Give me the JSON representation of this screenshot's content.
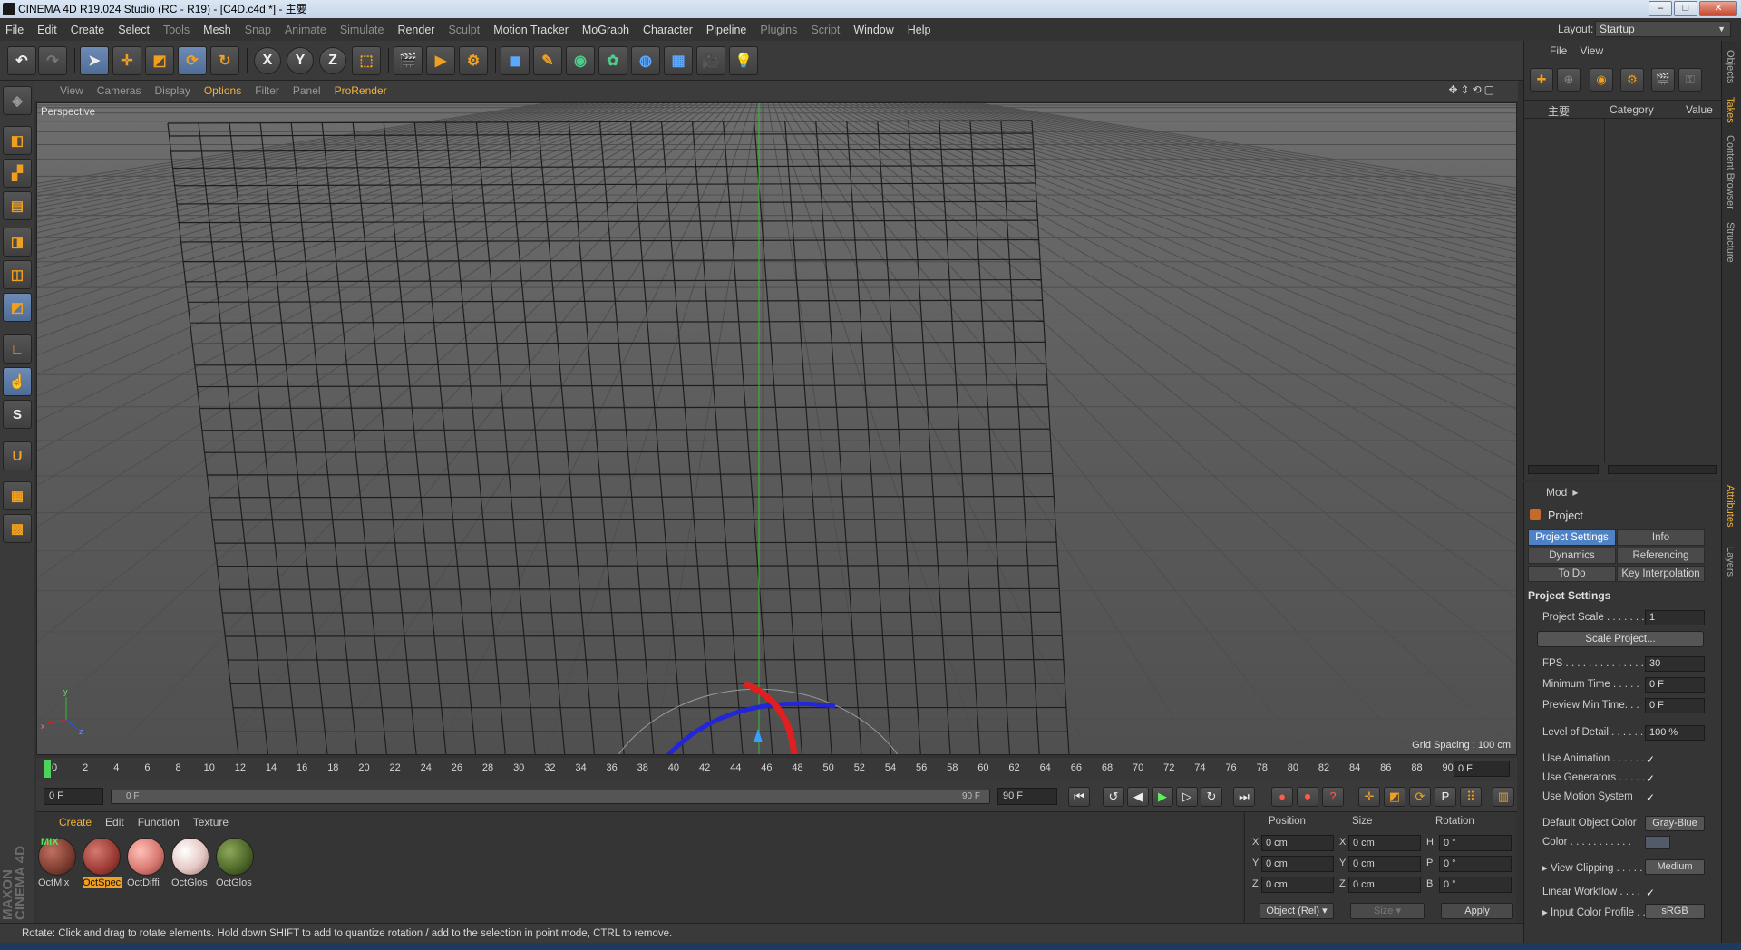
{
  "window": {
    "title": "CINEMA 4D R19.024 Studio (RC - R19) - [C4D.c4d *] - 主要",
    "controls": [
      "–",
      "□",
      "✕"
    ]
  },
  "menubar": {
    "items": [
      "File",
      "Edit",
      "Create",
      "Select",
      "Tools",
      "Mesh",
      "Snap",
      "Animate",
      "Simulate",
      "Render",
      "Sculpt",
      "Motion Tracker",
      "MoGraph",
      "Character",
      "Pipeline",
      "Plugins",
      "Script",
      "Window",
      "Help"
    ]
  },
  "layout": {
    "label": "Layout:",
    "value": "Startup"
  },
  "viewport": {
    "menu": [
      "View",
      "Cameras",
      "Display",
      "Options",
      "Filter",
      "Panel",
      "ProRender"
    ],
    "label": "Perspective",
    "grid_spacing": "Grid Spacing : 100 cm",
    "axis": {
      "x": "x",
      "y": "y",
      "z": "z"
    }
  },
  "timeline": {
    "ticks": [
      "0",
      "2",
      "4",
      "6",
      "8",
      "10",
      "12",
      "14",
      "16",
      "18",
      "20",
      "22",
      "24",
      "26",
      "28",
      "30",
      "32",
      "34",
      "36",
      "38",
      "40",
      "42",
      "44",
      "46",
      "48",
      "50",
      "52",
      "54",
      "56",
      "58",
      "60",
      "62",
      "64",
      "66",
      "68",
      "70",
      "72",
      "74",
      "76",
      "78",
      "80",
      "82",
      "84",
      "86",
      "88",
      "90"
    ],
    "end_field": "0 F",
    "start": "0 F",
    "slider_start": "0 F",
    "slider_end": "90 F",
    "max": "90 F"
  },
  "materials": {
    "menu": [
      "Create",
      "Edit",
      "Function",
      "Texture"
    ],
    "items": [
      {
        "name": "OctMix",
        "color": "#7a3b2e",
        "tag": "MIX"
      },
      {
        "name": "OctSpec",
        "color": "#9a3a32"
      },
      {
        "name": "OctDiffi",
        "color": "#d97a72"
      },
      {
        "name": "OctGlos",
        "color": "#e6c8c4"
      },
      {
        "name": "OctGlos",
        "color": "#4f6a2a"
      }
    ]
  },
  "coords": {
    "headers": [
      "Position",
      "Size",
      "Rotation"
    ],
    "rows": [
      {
        "a": "X",
        "pos": "0 cm",
        "b": "X",
        "size": "0 cm",
        "c": "H",
        "rot": "0 °"
      },
      {
        "a": "Y",
        "pos": "0 cm",
        "b": "Y",
        "size": "0 cm",
        "c": "P",
        "rot": "0 °"
      },
      {
        "a": "Z",
        "pos": "0 cm",
        "b": "Z",
        "size": "0 cm",
        "c": "B",
        "rot": "0 °"
      }
    ],
    "mode": "Object (Rel)",
    "size_mode": "Size",
    "apply": "Apply"
  },
  "status": "Rotate: Click and drag to rotate elements. Hold down SHIFT to add to quantize rotation / add to the selection in point mode, CTRL to remove.",
  "object_manager": {
    "menu": [
      "File",
      "View"
    ],
    "col1": "主要",
    "col2": "Category",
    "col3": "Value"
  },
  "attributes": {
    "menu": "Mod",
    "title": "Project",
    "tabs": [
      "Project Settings",
      "Info",
      "Dynamics",
      "Referencing",
      "To Do",
      "Key Interpolation"
    ],
    "section": "Project Settings",
    "scale_label": "Project Scale . . . . . . .",
    "scale": "1",
    "scale_button": "Scale Project...",
    "fps_label": "FPS . . . . . . . . . . . . . .",
    "fps": "30",
    "min_time_label": "Minimum Time . . . . .",
    "min_time": "0 F",
    "preview_min_label": "Preview Min Time. . .",
    "preview_min": "0 F",
    "lod_label": "Level of Detail . . . . . .",
    "lod": "100 %",
    "use_anim_label": "Use Animation . . . . . .",
    "use_gen_label": "Use Generators . . . . .",
    "use_motion_label": "Use Motion System",
    "check": "✓",
    "def_color_label": "Default Object Color",
    "def_color": "Gray-Blue",
    "color_label": "Color . . . . . . . . . . .",
    "view_clip_label": "View Clipping . . . . . .",
    "view_clip": "Medium",
    "linear_label": "Linear Workflow . . . .",
    "icp_label": "Input Color Profile . .",
    "icp": "sRGB"
  },
  "side_tabs": [
    "Objects",
    "Takes",
    "Content Browser",
    "Structure",
    "Attributes",
    "Layers"
  ]
}
